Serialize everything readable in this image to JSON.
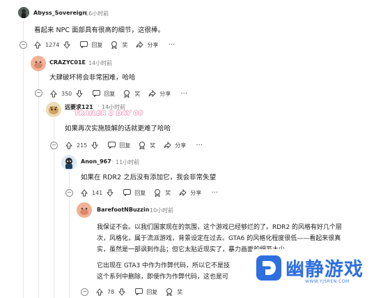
{
  "comments": [
    {
      "user": "Abyss_Sovereign",
      "time": "16小时前",
      "text": "看起来 NPC 面部具有很高的细节，这很棒。",
      "upvotes": "1274",
      "reply": "回复",
      "award": "奖",
      "share": "分享"
    },
    {
      "user": "CRAZYC01E",
      "time": "14小时前",
      "text": "大肆破坏将会非常困难，哈哈",
      "upvotes": "350",
      "reply": "回复",
      "award": "奖",
      "share": "分享"
    },
    {
      "user": "远要求121",
      "flair": "TRAILER 2 DAY 06",
      "time": "14小时前",
      "text": "如果再次实施肢解的话就更难了哈哈",
      "upvotes": "215",
      "reply": "回复",
      "award": "奖",
      "share": "分享"
    },
    {
      "user": "Anon_967",
      "time": "11小时前",
      "text": "如果在 RDR2 之后没有添加它，我会非常失望",
      "upvotes": "141",
      "reply": "回复",
      "award": "奖",
      "share": "分享"
    },
    {
      "user": "BarefootNBuzzin",
      "time": "10小时前",
      "text_lines": [
        "我保证不会。以我们国家现在的氛围，这个游戏已经够烂的了。RDR2 的风格有好几个层",
        "次，风格化，属于流派游戏，背景设定在过去。GTA6 的风格化程度很低——看起来很真",
        "实，虽然是一部讽刺作品；但它太贴近现实了，暴力画面的细节太少。",
        "它出现在 GTA3 中作为作弊代码，所以它不是技",
        "这个系列中删除，即使作为作弊代码，这也是可"
      ],
      "upvotes": "78",
      "reply": "回复",
      "award": "奖",
      "share": "分享"
    }
  ],
  "watermark": {
    "title": "幽静游戏",
    "url": "WWW.YJSREN.COM"
  },
  "colors": {
    "accent": "#2f6fe0",
    "thread_line": "#e5e7ea",
    "flair": "#f6a4c4"
  }
}
